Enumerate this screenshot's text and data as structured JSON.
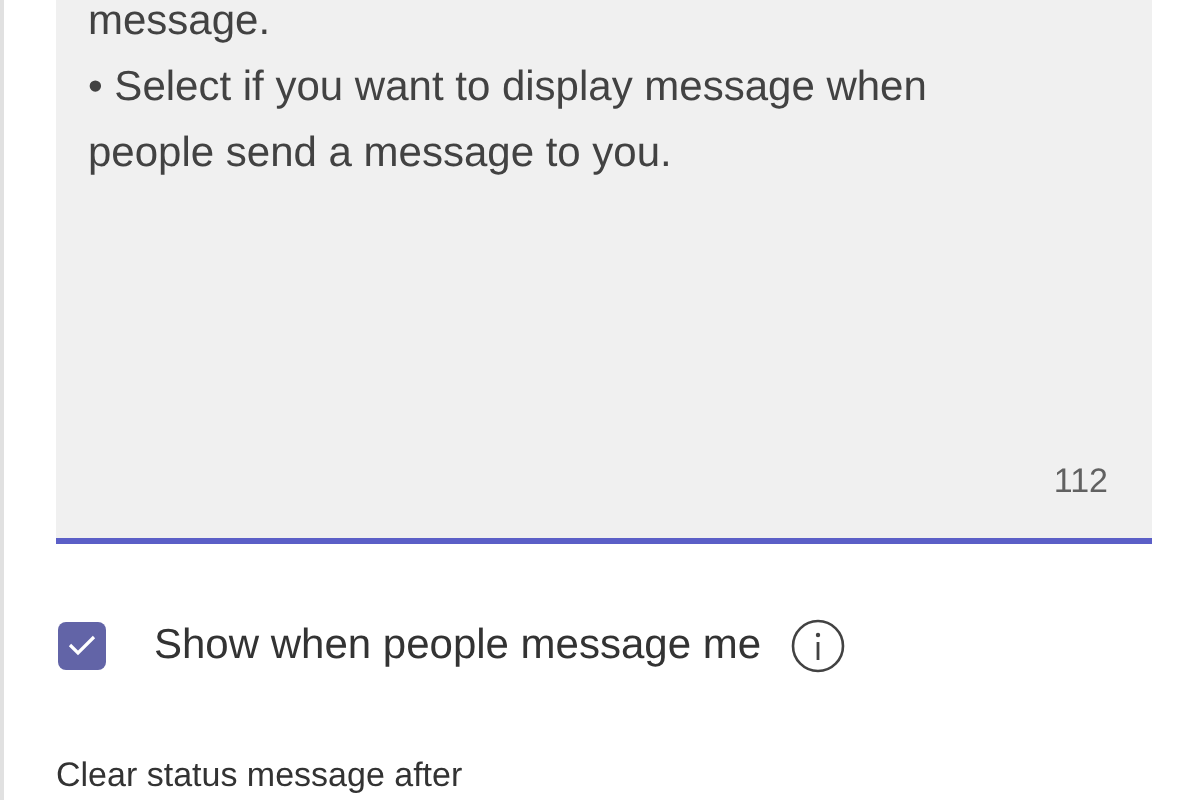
{
  "message_field": {
    "lines": [
      "message.",
      "• Select if you want to display message when",
      "people send a message to you."
    ],
    "focused": true,
    "counter": "112"
  },
  "show_when_messaged": {
    "label": "Show when people message me",
    "checked": true
  },
  "clear_after": {
    "label": "Clear status message after"
  }
}
